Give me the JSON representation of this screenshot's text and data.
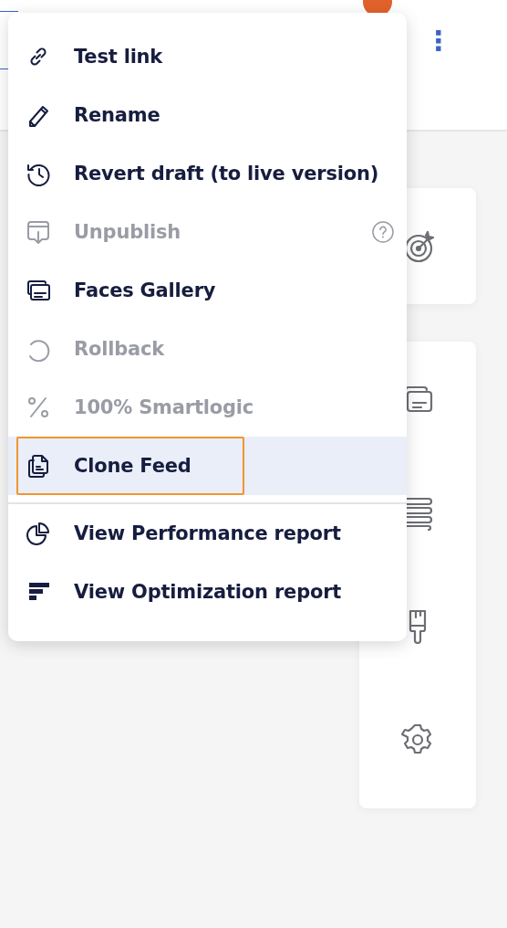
{
  "header": {
    "more_button": "⋮"
  },
  "menu": {
    "items": [
      {
        "label": "Test link",
        "disabled": false,
        "selected": false,
        "focused": false,
        "help_icon": false,
        "separator_before": false
      },
      {
        "label": "Rename",
        "disabled": false,
        "selected": false,
        "focused": false,
        "help_icon": false,
        "separator_before": false
      },
      {
        "label": "Revert draft (to live version)",
        "disabled": false,
        "selected": false,
        "focused": false,
        "help_icon": false,
        "separator_before": false
      },
      {
        "label": "Unpublish",
        "disabled": true,
        "selected": false,
        "focused": false,
        "help_icon": true,
        "separator_before": false
      },
      {
        "label": "Faces Gallery",
        "disabled": false,
        "selected": false,
        "focused": false,
        "help_icon": false,
        "separator_before": false
      },
      {
        "label": "Rollback",
        "disabled": true,
        "selected": false,
        "focused": false,
        "help_icon": false,
        "separator_before": false
      },
      {
        "label": "100% Smartlogic",
        "disabled": true,
        "selected": false,
        "focused": false,
        "help_icon": false,
        "separator_before": false
      },
      {
        "label": "Clone Feed",
        "disabled": false,
        "selected": true,
        "focused": true,
        "help_icon": false,
        "separator_before": false
      },
      {
        "label": "View Performance report",
        "disabled": false,
        "selected": false,
        "focused": false,
        "help_icon": false,
        "separator_before": true
      },
      {
        "label": "View Optimization report",
        "disabled": false,
        "selected": false,
        "focused": false,
        "help_icon": false,
        "separator_before": false
      }
    ]
  }
}
